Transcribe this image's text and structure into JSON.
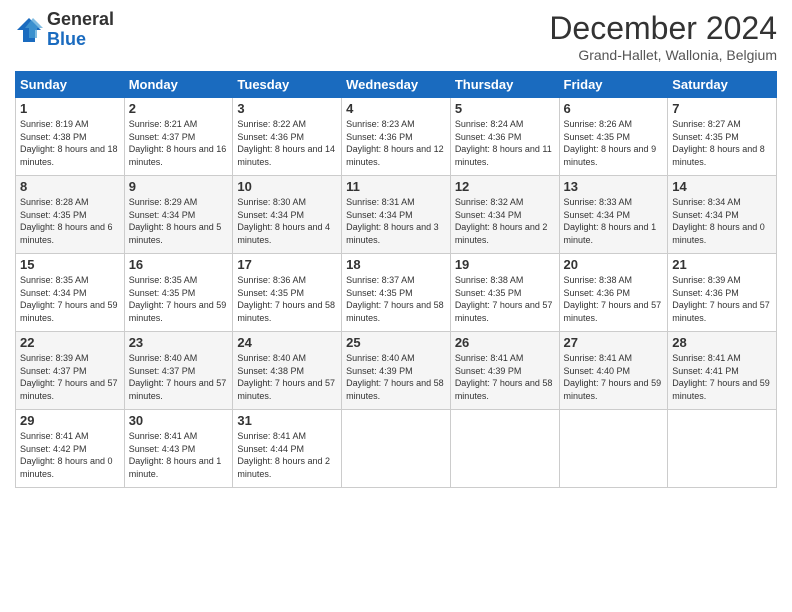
{
  "logo": {
    "general": "General",
    "blue": "Blue"
  },
  "title": "December 2024",
  "location": "Grand-Hallet, Wallonia, Belgium",
  "days_of_week": [
    "Sunday",
    "Monday",
    "Tuesday",
    "Wednesday",
    "Thursday",
    "Friday",
    "Saturday"
  ],
  "weeks": [
    [
      {
        "day": "1",
        "sunrise": "8:19 AM",
        "sunset": "4:38 PM",
        "daylight": "8 hours and 18 minutes."
      },
      {
        "day": "2",
        "sunrise": "8:21 AM",
        "sunset": "4:37 PM",
        "daylight": "8 hours and 16 minutes."
      },
      {
        "day": "3",
        "sunrise": "8:22 AM",
        "sunset": "4:36 PM",
        "daylight": "8 hours and 14 minutes."
      },
      {
        "day": "4",
        "sunrise": "8:23 AM",
        "sunset": "4:36 PM",
        "daylight": "8 hours and 12 minutes."
      },
      {
        "day": "5",
        "sunrise": "8:24 AM",
        "sunset": "4:36 PM",
        "daylight": "8 hours and 11 minutes."
      },
      {
        "day": "6",
        "sunrise": "8:26 AM",
        "sunset": "4:35 PM",
        "daylight": "8 hours and 9 minutes."
      },
      {
        "day": "7",
        "sunrise": "8:27 AM",
        "sunset": "4:35 PM",
        "daylight": "8 hours and 8 minutes."
      }
    ],
    [
      {
        "day": "8",
        "sunrise": "8:28 AM",
        "sunset": "4:35 PM",
        "daylight": "8 hours and 6 minutes."
      },
      {
        "day": "9",
        "sunrise": "8:29 AM",
        "sunset": "4:34 PM",
        "daylight": "8 hours and 5 minutes."
      },
      {
        "day": "10",
        "sunrise": "8:30 AM",
        "sunset": "4:34 PM",
        "daylight": "8 hours and 4 minutes."
      },
      {
        "day": "11",
        "sunrise": "8:31 AM",
        "sunset": "4:34 PM",
        "daylight": "8 hours and 3 minutes."
      },
      {
        "day": "12",
        "sunrise": "8:32 AM",
        "sunset": "4:34 PM",
        "daylight": "8 hours and 2 minutes."
      },
      {
        "day": "13",
        "sunrise": "8:33 AM",
        "sunset": "4:34 PM",
        "daylight": "8 hours and 1 minute."
      },
      {
        "day": "14",
        "sunrise": "8:34 AM",
        "sunset": "4:34 PM",
        "daylight": "8 hours and 0 minutes."
      }
    ],
    [
      {
        "day": "15",
        "sunrise": "8:35 AM",
        "sunset": "4:34 PM",
        "daylight": "7 hours and 59 minutes."
      },
      {
        "day": "16",
        "sunrise": "8:35 AM",
        "sunset": "4:35 PM",
        "daylight": "7 hours and 59 minutes."
      },
      {
        "day": "17",
        "sunrise": "8:36 AM",
        "sunset": "4:35 PM",
        "daylight": "7 hours and 58 minutes."
      },
      {
        "day": "18",
        "sunrise": "8:37 AM",
        "sunset": "4:35 PM",
        "daylight": "7 hours and 58 minutes."
      },
      {
        "day": "19",
        "sunrise": "8:38 AM",
        "sunset": "4:35 PM",
        "daylight": "7 hours and 57 minutes."
      },
      {
        "day": "20",
        "sunrise": "8:38 AM",
        "sunset": "4:36 PM",
        "daylight": "7 hours and 57 minutes."
      },
      {
        "day": "21",
        "sunrise": "8:39 AM",
        "sunset": "4:36 PM",
        "daylight": "7 hours and 57 minutes."
      }
    ],
    [
      {
        "day": "22",
        "sunrise": "8:39 AM",
        "sunset": "4:37 PM",
        "daylight": "7 hours and 57 minutes."
      },
      {
        "day": "23",
        "sunrise": "8:40 AM",
        "sunset": "4:37 PM",
        "daylight": "7 hours and 57 minutes."
      },
      {
        "day": "24",
        "sunrise": "8:40 AM",
        "sunset": "4:38 PM",
        "daylight": "7 hours and 57 minutes."
      },
      {
        "day": "25",
        "sunrise": "8:40 AM",
        "sunset": "4:39 PM",
        "daylight": "7 hours and 58 minutes."
      },
      {
        "day": "26",
        "sunrise": "8:41 AM",
        "sunset": "4:39 PM",
        "daylight": "7 hours and 58 minutes."
      },
      {
        "day": "27",
        "sunrise": "8:41 AM",
        "sunset": "4:40 PM",
        "daylight": "7 hours and 59 minutes."
      },
      {
        "day": "28",
        "sunrise": "8:41 AM",
        "sunset": "4:41 PM",
        "daylight": "7 hours and 59 minutes."
      }
    ],
    [
      {
        "day": "29",
        "sunrise": "8:41 AM",
        "sunset": "4:42 PM",
        "daylight": "8 hours and 0 minutes."
      },
      {
        "day": "30",
        "sunrise": "8:41 AM",
        "sunset": "4:43 PM",
        "daylight": "8 hours and 1 minute."
      },
      {
        "day": "31",
        "sunrise": "8:41 AM",
        "sunset": "4:44 PM",
        "daylight": "8 hours and 2 minutes."
      },
      null,
      null,
      null,
      null
    ]
  ]
}
